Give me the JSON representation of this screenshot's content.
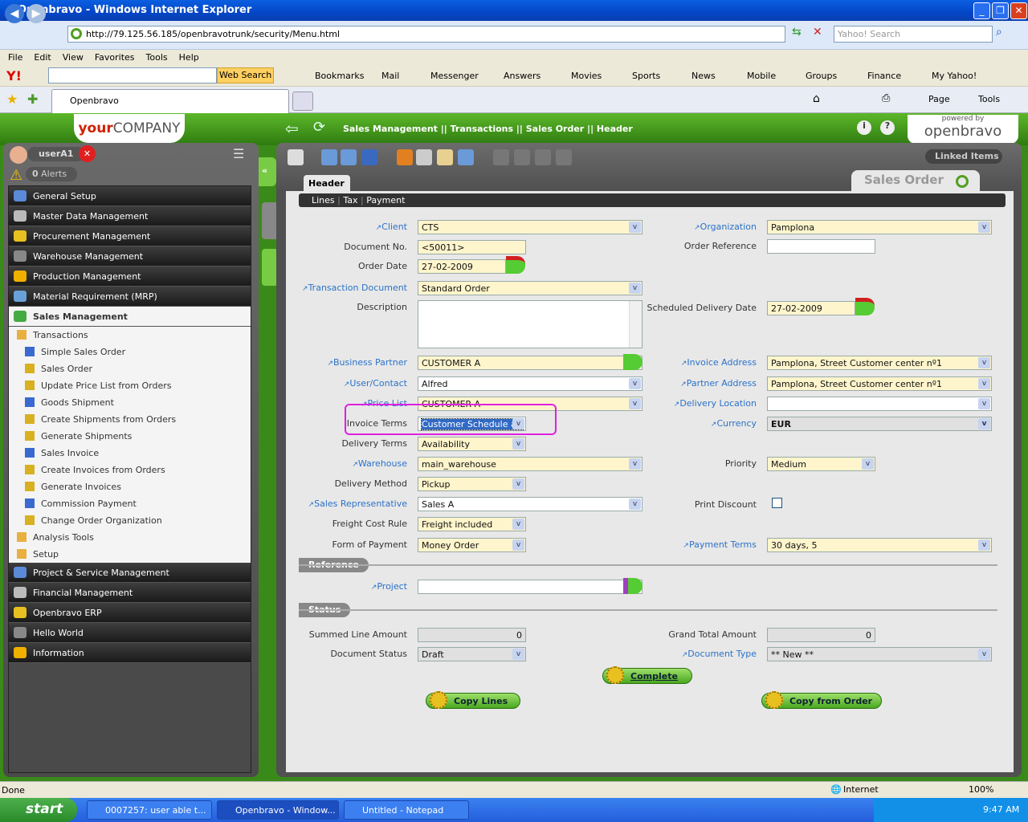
{
  "browser": {
    "title": "Openbravo - Windows Internet Explorer",
    "url": "http://79.125.56.185/openbravotrunk/security/Menu.html",
    "search_placeholder": "Yahoo! Search",
    "menu": [
      "File",
      "Edit",
      "View",
      "Favorites",
      "Tools",
      "Help"
    ],
    "yahoo": {
      "web_search": "Web Search",
      "items": [
        "Bookmarks",
        "Mail",
        "Messenger",
        "Answers",
        "Movies",
        "Sports",
        "News",
        "Mobile",
        "Groups",
        "Finance",
        "My Yahoo!"
      ]
    },
    "tab": "Openbravo",
    "cmd": {
      "page": "Page",
      "tools": "Tools"
    }
  },
  "app": {
    "company_your": "your",
    "company_name": "COMPANY",
    "breadcrumb": "Sales Management || Transactions || Sales Order || Header",
    "powered": "powered by",
    "brand": "openbravo",
    "user": "userA1",
    "alerts_count": "0",
    "alerts_label": "Alerts",
    "linked_items": "Linked Items",
    "window_title": "Sales Order",
    "tab_header": "Header",
    "subtabs": [
      "Lines",
      "Tax",
      "Payment"
    ]
  },
  "sidebar": {
    "top": [
      "General Setup",
      "Master Data Management",
      "Procurement Management",
      "Warehouse Management",
      "Production Management",
      "Material Requirement (MRP)"
    ],
    "open": "Sales Management",
    "sub": [
      {
        "label": "Transactions",
        "lvl": 1
      },
      {
        "label": "Simple Sales Order",
        "lvl": 2
      },
      {
        "label": "Sales Order",
        "lvl": 2
      },
      {
        "label": "Update Price List from Orders",
        "lvl": 2
      },
      {
        "label": "Goods Shipment",
        "lvl": 2
      },
      {
        "label": "Create Shipments from Orders",
        "lvl": 2
      },
      {
        "label": "Generate Shipments",
        "lvl": 2
      },
      {
        "label": "Sales Invoice",
        "lvl": 2
      },
      {
        "label": "Create Invoices from Orders",
        "lvl": 2
      },
      {
        "label": "Generate Invoices",
        "lvl": 2
      },
      {
        "label": "Commission Payment",
        "lvl": 2
      },
      {
        "label": "Change Order Organization",
        "lvl": 2
      },
      {
        "label": "Analysis Tools",
        "lvl": 1
      },
      {
        "label": "Setup",
        "lvl": 1
      }
    ],
    "bottom": [
      "Project & Service Management",
      "Financial Management",
      "Openbravo ERP",
      "Hello World",
      "Information"
    ]
  },
  "form": {
    "fields": [
      {
        "label": "Client",
        "value": "CTS"
      },
      {
        "label": "Document No.",
        "value": "<50011>"
      },
      {
        "label": "Order Date",
        "value": "27-02-2009"
      },
      {
        "label": "Transaction Document",
        "value": "Standard Order"
      },
      {
        "label": "Description",
        "value": ""
      },
      {
        "label": "Business Partner",
        "value": "CUSTOMER A"
      },
      {
        "label": "User/Contact",
        "value": "Alfred"
      },
      {
        "label": "Price List",
        "value": "CUSTOMER A"
      },
      {
        "label": "Invoice Terms",
        "value": "Customer Schedule aft"
      },
      {
        "label": "Delivery Terms",
        "value": "Availability"
      },
      {
        "label": "Warehouse",
        "value": "main_warehouse"
      },
      {
        "label": "Delivery Method",
        "value": "Pickup"
      },
      {
        "label": "Sales Representative",
        "value": "Sales A"
      },
      {
        "label": "Freight Cost Rule",
        "value": "Freight included"
      },
      {
        "label": "Form of Payment",
        "value": "Money Order"
      },
      {
        "label": "Organization",
        "value": "Pamplona"
      },
      {
        "label": "Order Reference",
        "value": ""
      },
      {
        "label": "Scheduled Delivery Date",
        "value": "27-02-2009"
      },
      {
        "label": "Invoice Address",
        "value": "Pamplona, Street Customer center nº1"
      },
      {
        "label": "Partner Address",
        "value": "Pamplona, Street Customer center nº1"
      },
      {
        "label": "Delivery Location",
        "value": ""
      },
      {
        "label": "Currency",
        "value": "EUR"
      },
      {
        "label": "Priority",
        "value": "Medium"
      },
      {
        "label": "Print Discount",
        "value": ""
      },
      {
        "label": "Payment Terms",
        "value": "30 days, 5"
      },
      {
        "label": "Project",
        "value": ""
      },
      {
        "label": "Summed Line Amount",
        "value": "0"
      },
      {
        "label": "Document Status",
        "value": "Draft"
      },
      {
        "label": "Grand Total Amount",
        "value": "0"
      },
      {
        "label": "Document Type",
        "value": "** New **"
      }
    ],
    "section_reference": "Reference",
    "section_status": "Status",
    "buttons": {
      "complete": "Complete",
      "copy_lines": "Copy Lines",
      "copy_from_order": "Copy from Order"
    }
  },
  "statusbar": {
    "text": "Done",
    "zone": "Internet",
    "zoom": "100%"
  },
  "taskbar": {
    "start": "start",
    "tasks": [
      "0007257: user able t...",
      "Openbravo - Window...",
      "Untitled - Notepad"
    ],
    "time": "9:47 AM"
  },
  "colors": {
    "highlight": "#e020e0",
    "green": "#3a8a1a"
  }
}
